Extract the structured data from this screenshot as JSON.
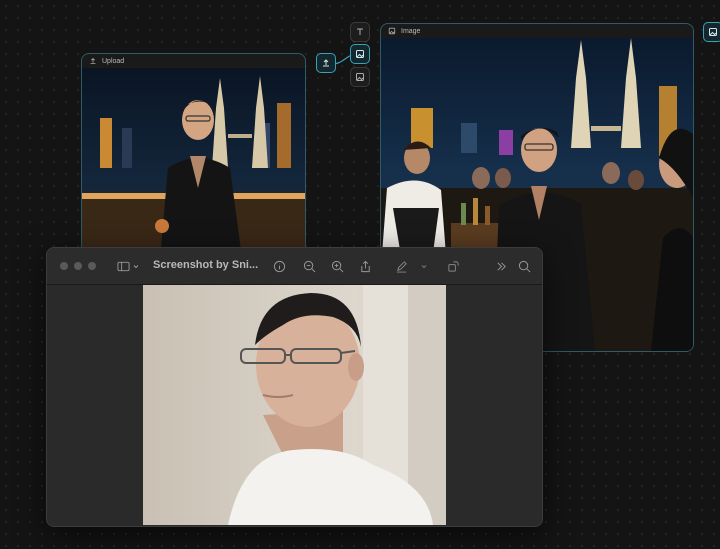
{
  "upload_node": {
    "label": "Upload",
    "icon": "upload-icon"
  },
  "image_node": {
    "label": "Image",
    "icon": "image-icon"
  },
  "toolbar": {
    "text_tool": "text-icon",
    "image_tool": "image-icon",
    "image_alt_tool": "image-icon",
    "upload_port": "upload-icon"
  },
  "preview_window": {
    "title": "Screenshot by Sni...",
    "sidebar_toggle": "sidebar-icon",
    "info": "info-icon",
    "zoom_out": "zoom-out-icon",
    "zoom_in": "zoom-in-icon",
    "share": "share-icon",
    "markup": "pen-icon",
    "rotate": "rotate-icon",
    "more": "chevrons-right-icon",
    "search": "search-icon"
  },
  "colors": {
    "accent": "#3aa0b8",
    "canvas": "#141414",
    "window": "#262626"
  }
}
